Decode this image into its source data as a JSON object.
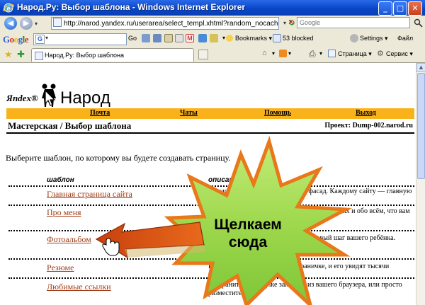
{
  "window": {
    "title": "Народ.Ру: Выбор шаблона - Windows Internet Explorer",
    "minimize_label": "_",
    "maximize_label": "□",
    "close_label": "✕"
  },
  "address_bar": {
    "url": "http://narod.yandex.ru/userarea/select_templ.xhtml?random_nocache=1052",
    "search_placeholder": "Google",
    "go_label": "Go",
    "refresh_label": "↻",
    "stop_label": "✕"
  },
  "google_toolbar": {
    "logo": "Google",
    "go_label": "Go",
    "bookmarks_label": "Bookmarks ▾",
    "blocked_label": "53 blocked",
    "settings_label": "Settings ▾",
    "file_label": "Файл"
  },
  "favorites_bar": {
    "tab_title": "Народ.Ру: Выбор шаблона",
    "page_label": "Страница ▾",
    "service_label": "Сервис ▾"
  },
  "page": {
    "logo_yandex": "Яndex®",
    "logo_narod": "Народ",
    "menu": [
      "Почта",
      "Чаты",
      "Помощь",
      "Выход"
    ],
    "breadcrumb_link": "Мастерская",
    "breadcrumb_sep": " / ",
    "breadcrumb_current": "Выбор шаблона",
    "project_label": "Проект: ",
    "project_link": "Dump-002.narod.ru",
    "intro": "Выберите шаблон, по которому вы будете создавать страницу.",
    "col_template": "шаблон",
    "col_description": "описание",
    "templates": [
      {
        "name": "Главная страница сайта",
        "desc": "Каждому дому полагается иметь фасад. Каждому сайту — главную страницу. Выберите свою."
      },
      {
        "name": "Про меня",
        "desc": "Расскажите о своих увлечениях, своих друзьях и обо всём, что вам интересно не только"
      },
      {
        "name": "Фотоальбом",
        "desc": "Фотографии из путешествия или первый шаг вашего ребёнка. Разместите свой"
      },
      {
        "name": "Резюме",
        "desc": "Расскажите о себе на вашей страничке, и его увидят тысячи компаний."
      },
      {
        "name": "Любимые ссылки",
        "desc": "Не храните их в ящике закладок из вашего браузера, или просто разместите на"
      }
    ]
  },
  "callout": {
    "line1": "Щелкаем",
    "line2": "сюда"
  },
  "colors": {
    "menu_bar": "#f9b21a",
    "link": "#a03d16",
    "starburst_fill": "#9bd64a",
    "starburst_border": "#e8781a",
    "arrow": "#c8410e"
  }
}
